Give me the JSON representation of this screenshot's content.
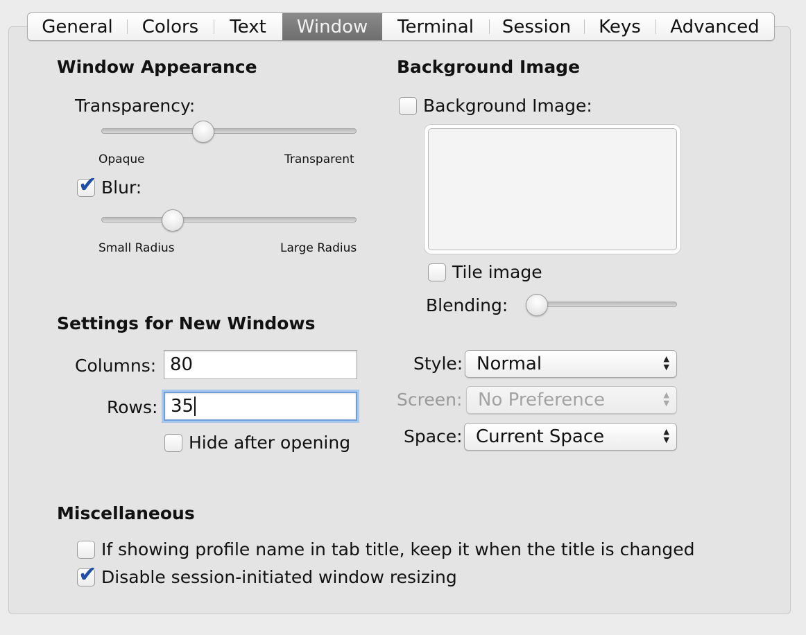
{
  "tabs": [
    {
      "label": "General",
      "active": false
    },
    {
      "label": "Colors",
      "active": false
    },
    {
      "label": "Text",
      "active": false
    },
    {
      "label": "Window",
      "active": true
    },
    {
      "label": "Terminal",
      "active": false
    },
    {
      "label": "Session",
      "active": false
    },
    {
      "label": "Keys",
      "active": false
    },
    {
      "label": "Advanced",
      "active": false
    }
  ],
  "window_appearance": {
    "heading": "Window Appearance",
    "transparency_label": "Transparency:",
    "transparency_value": 0.39,
    "transparency_min_label": "Opaque",
    "transparency_max_label": "Transparent",
    "blur_label": "Blur:",
    "blur_checked": true,
    "blur_value": 0.26,
    "blur_min_label": "Small Radius",
    "blur_max_label": "Large Radius"
  },
  "background_image": {
    "heading": "Background Image",
    "checkbox_label": "Background Image:",
    "checked": false,
    "tile_label": "Tile image",
    "tile_checked": false,
    "blending_label": "Blending:",
    "blending_value": 0.0
  },
  "new_windows": {
    "heading": "Settings for New Windows",
    "columns_label": "Columns:",
    "columns_value": "80",
    "rows_label": "Rows:",
    "rows_value": "35",
    "hide_label": "Hide after opening",
    "hide_checked": false,
    "style_label": "Style:",
    "style_value": "Normal",
    "screen_label": "Screen:",
    "screen_value": "No Preference",
    "space_label": "Space:",
    "space_value": "Current Space"
  },
  "misc": {
    "heading": "Miscellaneous",
    "profile_name_label": "If showing profile name in tab title, keep it when the title is changed",
    "profile_name_checked": false,
    "disable_resize_label": "Disable session-initiated window resizing",
    "disable_resize_checked": true
  },
  "colors": {
    "accent_check": "#1f4fa6",
    "active_tab": "#7a7a7a",
    "focus_ring": "#6e9fdc"
  }
}
